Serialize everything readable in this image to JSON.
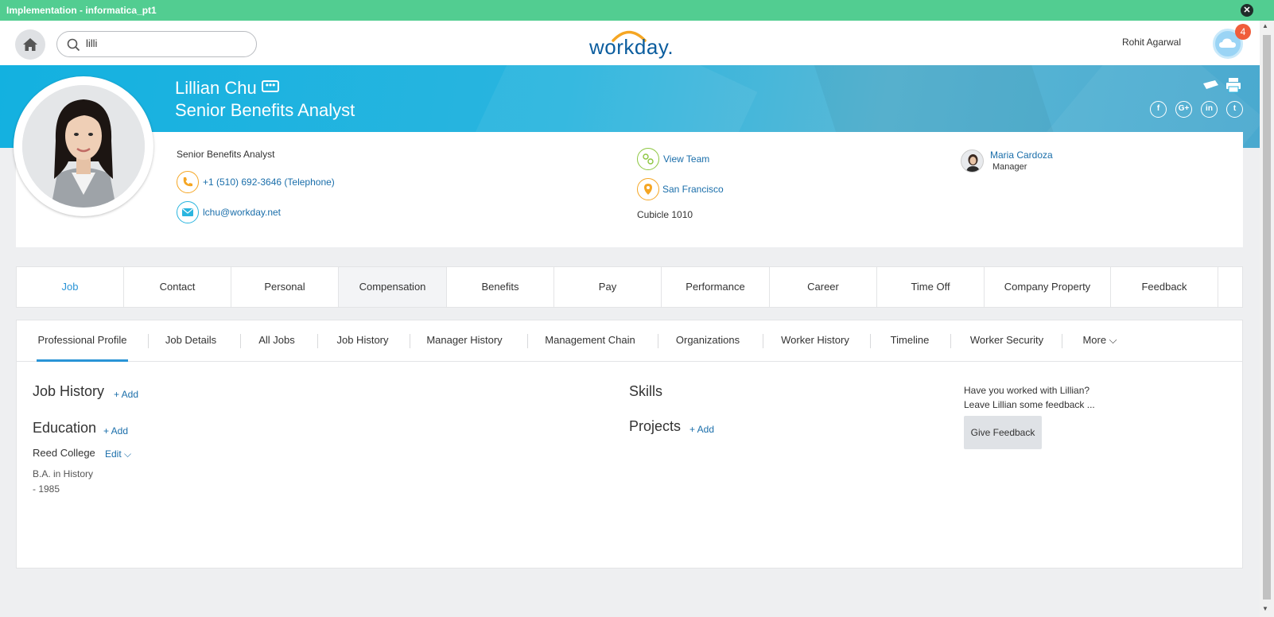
{
  "window": {
    "title": "Implementation - informatica_pt1",
    "close_glyph": "✕"
  },
  "topbar": {
    "search_value": "lilli",
    "logo_text": "workday.",
    "user_name": "Rohit Agarwal",
    "notification_count": "4"
  },
  "profile": {
    "name": "Lillian Chu",
    "job_title": "Senior Benefits Analyst",
    "related_actions_glyph": "•••",
    "social_icons": [
      "f",
      "G+",
      "in",
      "t"
    ]
  },
  "card": {
    "position": "Senior Benefits Analyst",
    "phone": "+1 (510) 692-3646 (Telephone)",
    "email": "lchu@workday.net",
    "view_team": "View Team",
    "location": "San Francisco",
    "cubicle": "Cubicle 1010",
    "manager_name": "Maria Cardoza",
    "manager_label": "Manager"
  },
  "tabs": [
    {
      "label": "Job"
    },
    {
      "label": "Contact"
    },
    {
      "label": "Personal"
    },
    {
      "label": "Compensation"
    },
    {
      "label": "Benefits"
    },
    {
      "label": "Pay"
    },
    {
      "label": "Performance"
    },
    {
      "label": "Career"
    },
    {
      "label": "Time Off"
    },
    {
      "label": "Company Property"
    },
    {
      "label": "Feedback"
    }
  ],
  "subtabs": [
    {
      "label": "Professional Profile"
    },
    {
      "label": "Job Details"
    },
    {
      "label": "All Jobs"
    },
    {
      "label": "Job History"
    },
    {
      "label": "Manager History"
    },
    {
      "label": "Management Chain"
    },
    {
      "label": "Organizations"
    },
    {
      "label": "Worker History"
    },
    {
      "label": "Timeline"
    },
    {
      "label": "Worker Security"
    },
    {
      "label": "More ⌵"
    }
  ],
  "content": {
    "job_history_heading": "Job History",
    "education_heading": "Education",
    "skills_heading": "Skills",
    "projects_heading": "Projects",
    "add_label": "+ Add",
    "school": "Reed College",
    "edit_label": "Edit ⌵",
    "degree": "B.A. in History",
    "year": "- 1985",
    "feedback_q1": "Have you worked with Lillian?",
    "feedback_q2": "Leave Lillian some feedback ...",
    "give_feedback": "Give Feedback"
  }
}
